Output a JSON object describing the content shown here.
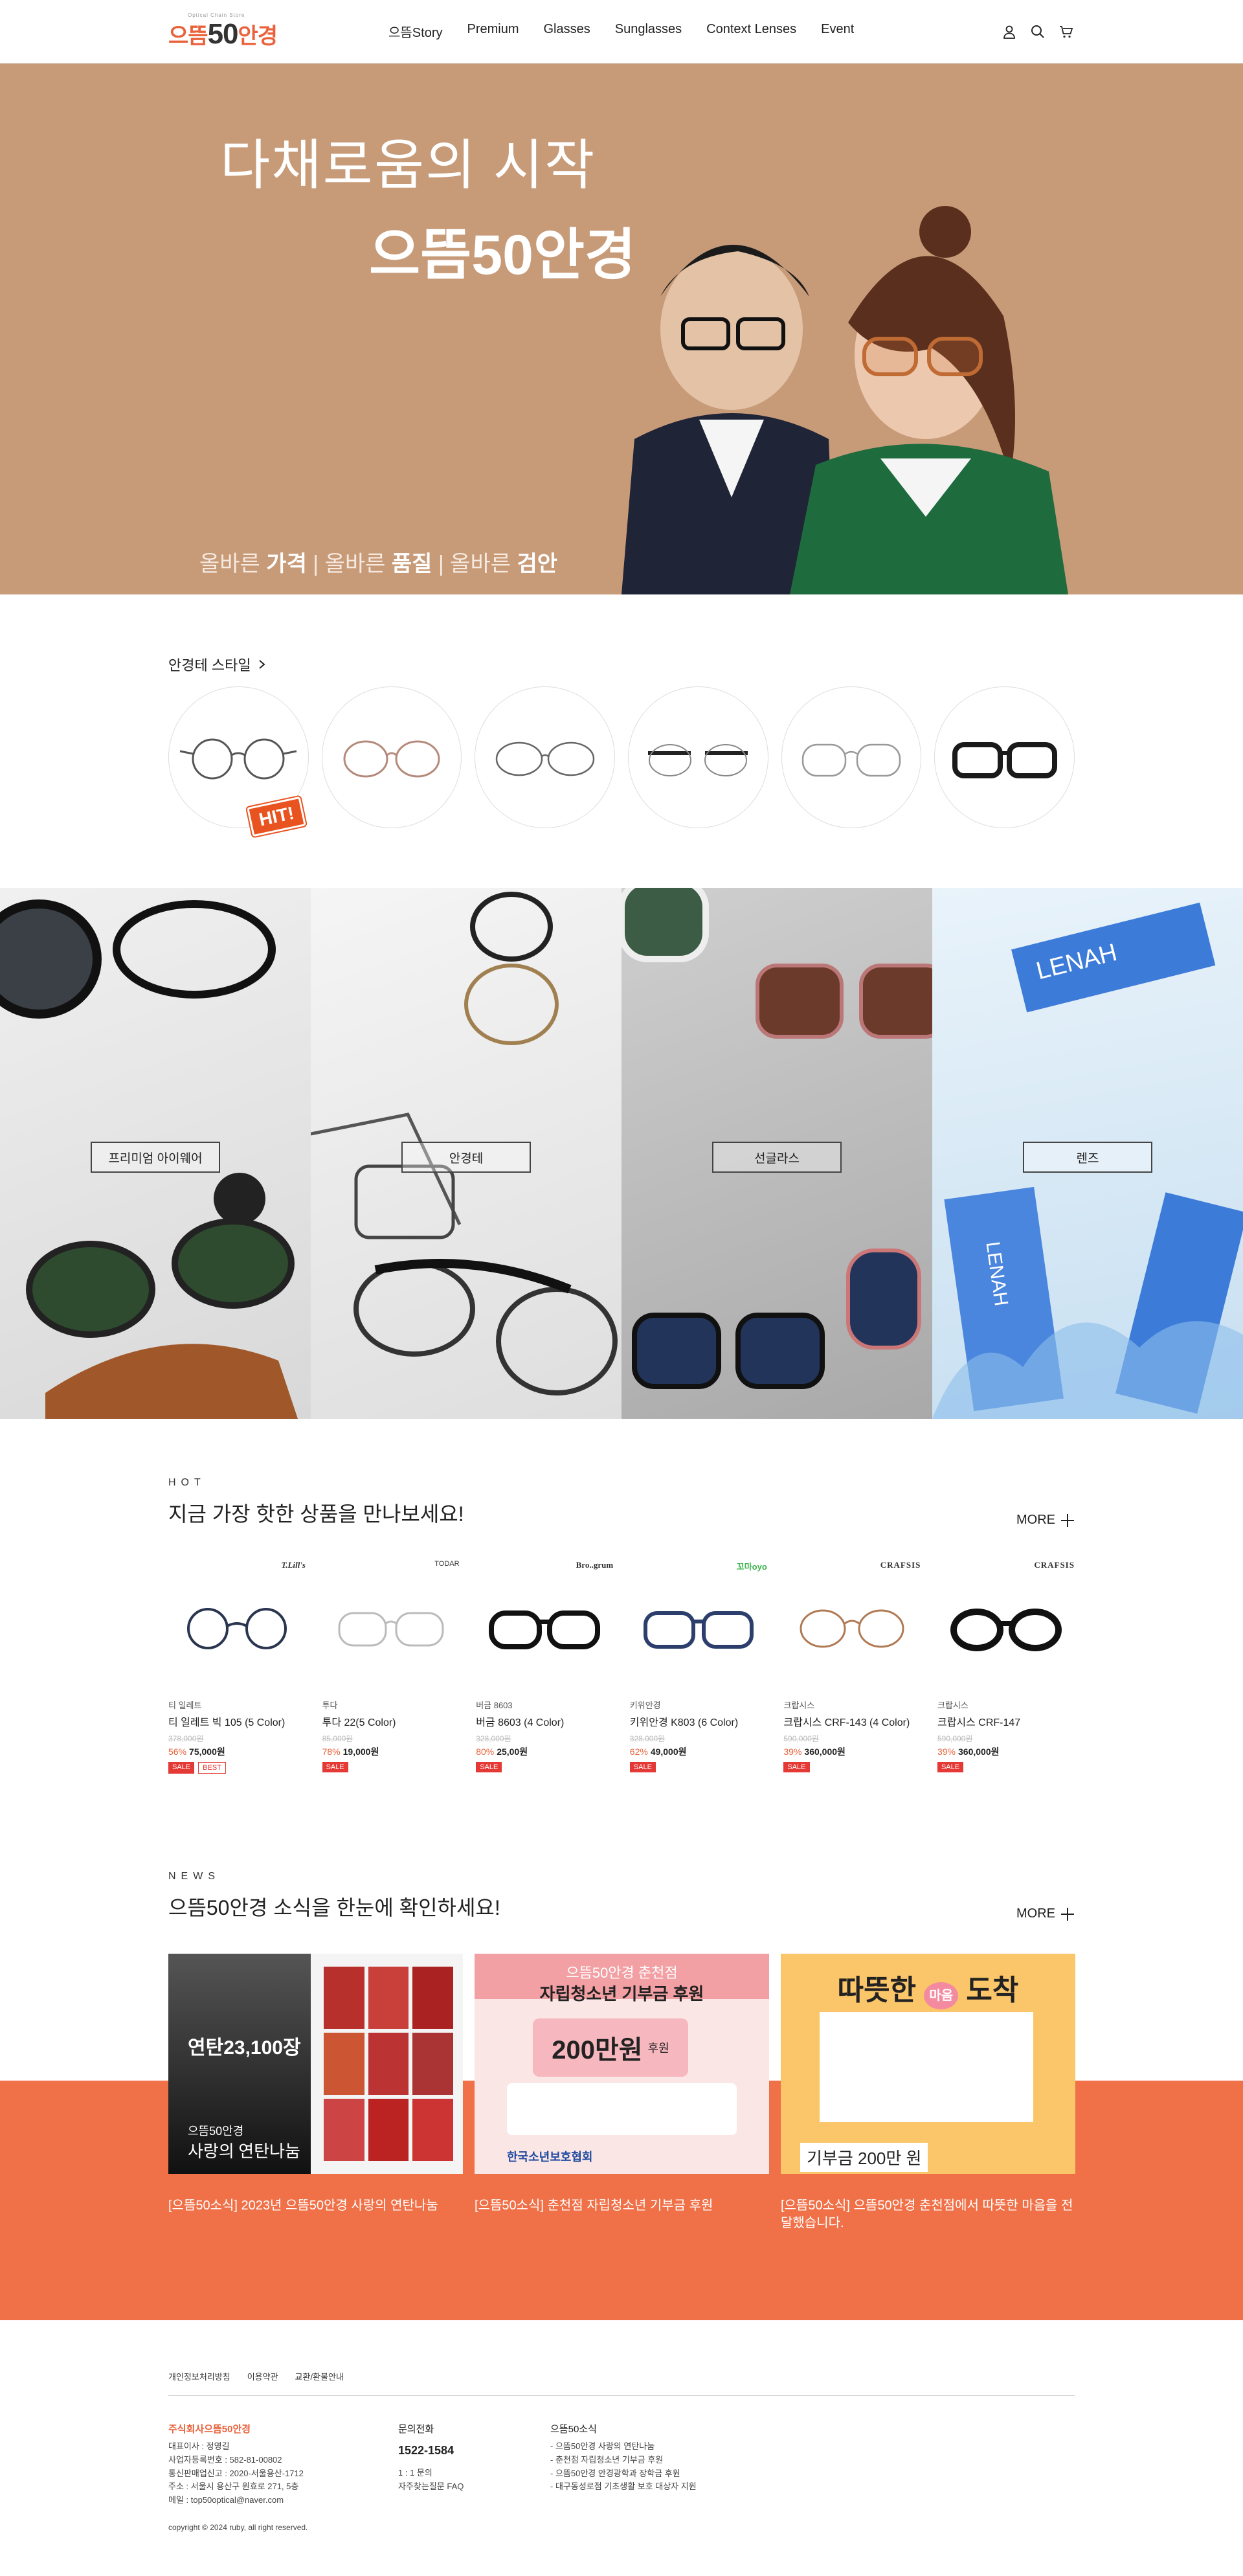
{
  "header": {
    "logo_sub": "Optical Chain Store",
    "logo_pre": "으뜸",
    "logo_num": "50",
    "logo_post": "안경",
    "nav": [
      "으뜸Story",
      "Premium",
      "Glasses",
      "Sunglasses",
      "Context Lenses",
      "Event"
    ],
    "icons": [
      "user-icon",
      "search-icon",
      "cart-icon"
    ]
  },
  "hero": {
    "line1": "다채로움의 시작",
    "line2": "으뜸50안경",
    "tag_pre1": "올바른 ",
    "tag_b1": "가격",
    "tag_pre2": " | 올바른 ",
    "tag_b2": "품질",
    "tag_pre3": " | 올바른 ",
    "tag_b3": "검안",
    "bg_color": "#c79a78"
  },
  "frames": {
    "title": "안경테 스타일",
    "hit_label": "HIT!"
  },
  "categories": [
    {
      "label": "프리미엄 아이웨어",
      "bg": "#e7e7e7"
    },
    {
      "label": "안경테",
      "bg": "#ededed"
    },
    {
      "label": "선글라스",
      "bg": "#bfbfbf"
    },
    {
      "label": "렌즈",
      "bg": "#dbe9f3"
    }
  ],
  "hot": {
    "eyebrow": "HOT",
    "title": "지금 가장 핫한 상품을 만나보세요!",
    "more": "MORE",
    "products": [
      {
        "brandlogo": "T.Lill's",
        "brand": "티 일레트",
        "name": "티 일레트 빅 105 (5 Color)",
        "orig": "378,000원",
        "rate": "56%",
        "price": "75,000원",
        "badges": [
          "SALE",
          "BEST"
        ]
      },
      {
        "brandlogo": "TODAR",
        "brand": "투다",
        "name": "투다 22(5 Color)",
        "orig": "85,000원",
        "rate": "78%",
        "price": "19,000원",
        "badges": [
          "SALE"
        ]
      },
      {
        "brandlogo": "Bro..grum",
        "brand": "버금 8603",
        "name": "버금 8603 (4 Color)",
        "orig": "328,000원",
        "rate": "80%",
        "price": "25,00원",
        "badges": [
          "SALE"
        ]
      },
      {
        "brandlogo": "꼬마oyo",
        "brand": "키위안경",
        "name": "키위안경 K803 (6 Color)",
        "orig": "328,000원",
        "rate": "62%",
        "price": "49,000원",
        "badges": [
          "SALE"
        ]
      },
      {
        "brandlogo": "CRAFSIS",
        "brand": "크랍시스",
        "name": "크랍시스 CRF-143 (4 Color)",
        "orig": "590,000원",
        "rate": "39%",
        "price": "360,000원",
        "badges": [
          "SALE"
        ]
      },
      {
        "brandlogo": "CRAFSIS",
        "brand": "크랍시스",
        "name": "크랍시스 CRF-147",
        "orig": "590,000원",
        "rate": "39%",
        "price": "360,000원",
        "badges": [
          "SALE"
        ]
      }
    ]
  },
  "news": {
    "eyebrow": "NEWS",
    "title": "으뜸50안경 소식을 한눈에 확인하세요!",
    "more": "MORE",
    "items": [
      {
        "caption": "[으뜸50소식] 2023년 으뜸50안경 사랑의 연탄나눔",
        "thumb_a": "연탄23,100장",
        "thumb_b": "으뜸50안경",
        "thumb_c": "사랑의 연탄나눔"
      },
      {
        "caption": "[으뜸50소식] 춘천점 자립청소년 기부금 후원",
        "thumb_a": "으뜸50안경 춘천점",
        "thumb_b": "자립청소년 기부금 후원",
        "thumb_c": "200만원",
        "thumb_d": "후원",
        "thumb_e": "한국소년보호협회"
      },
      {
        "caption": "[으뜸50소식] 으뜸50안경 춘천점에서 따뜻한 마음을 전달했습니다.",
        "thumb_a": "따뜻한",
        "thumb_b": "마음",
        "thumb_c": "도착",
        "thumb_d": "기부금 200만 원"
      }
    ]
  },
  "footer": {
    "links": [
      "개인정보처리방침",
      "이용약관",
      "교환/환불안내"
    ],
    "company": "주식회사으뜸50안경",
    "company_lines": [
      "대표이사 : 정영길",
      "사업자등록번호 : 582-81-00802",
      "통신판매업신고 : 2020-서울용산-1712",
      "주소 : 서울시 용산구 원효로 271, 5층",
      "메일 : top50optical@naver.com"
    ],
    "cs_title": "문의전화",
    "tel": "1522-1584",
    "cs_lines": [
      "1 : 1 문의",
      "자주찾는질문 FAQ"
    ],
    "news_title": "으뜸50소식",
    "news_lines": [
      "- 으뜸50안경 사랑의 연탄나눔",
      "- 춘천점 자립청소년 기부금 후원",
      "- 으뜸50안경 안경광학과 장학금 후원",
      "- 대구동성로점 기초생활 보호 대상자 지원"
    ],
    "copyright": "copyright © 2024 ruby, all right reserved."
  }
}
